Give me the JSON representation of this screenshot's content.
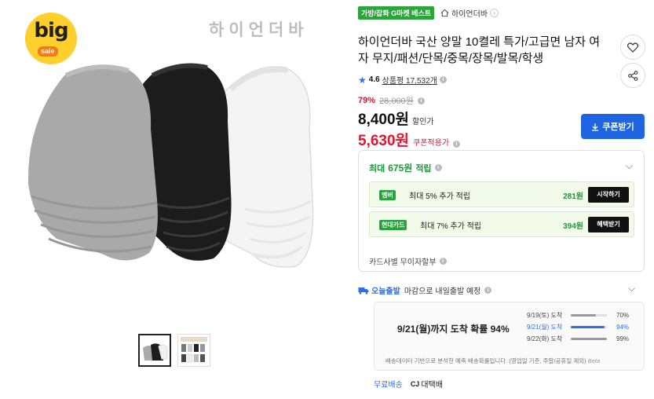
{
  "gallery": {
    "badge_big": "big",
    "badge_sale": "sale",
    "watermark": "하이언더바",
    "thumbnail_count": 2
  },
  "tags": {
    "best": "가방/잡화 G마켓 베스트",
    "store": "하이언더바",
    "store_chevron": "›"
  },
  "product": {
    "title": "하이언더바 국산 양말 10켤레 특가/고급면 남자 여자 무지/패션/단목/중목/장목/발목/학생",
    "rating": "4.6",
    "review_label": "상품평 17,532개"
  },
  "price": {
    "discount_rate": "79%",
    "original": "28,000원",
    "sale": "8,400원",
    "sale_label": "할인가",
    "coupon_price": "5,630원",
    "coupon_label": "쿠폰적용가",
    "coupon_button": "쿠폰받기"
  },
  "points": {
    "head_prefix": "최대",
    "head_amount": "675원",
    "head_suffix": "적립",
    "rows": [
      {
        "badge": "멤버",
        "text": "최대 5% 추가 적립",
        "amount": "281원",
        "button": "시작하기"
      },
      {
        "badge": "현대카드",
        "text": "최대 7% 추가 적립",
        "amount": "394원",
        "button": "혜택받기"
      }
    ],
    "installment": "카드사별 무이자할부"
  },
  "delivery": {
    "badge": "오늘출발",
    "text": "마감으로 내일출발 예정",
    "forecast_main": "9/21(월)까지 도착 확률 94%",
    "forecast": [
      {
        "date": "9/19(토) 도착",
        "pct": "70%",
        "value": 70
      },
      {
        "date": "9/21(월) 도착",
        "pct": "94%",
        "value": 94
      },
      {
        "date": "9/22(화) 도착",
        "pct": "99%",
        "value": 99
      }
    ],
    "note": "배송데이터 기반으로 분석한 예측 배송확률입니다. (영업일 기준, 주말/공휴일 제외)",
    "beta": "Beta",
    "free_shipping": "무료배송",
    "carrier": "대택배",
    "carrier_icon": "CJ"
  },
  "icons": {
    "info": "i",
    "star": "★",
    "chevron_down": "⌵"
  },
  "colors": {
    "accent_blue": "#1f64e0",
    "red": "#e6132d",
    "green": "#1a9a3a"
  }
}
